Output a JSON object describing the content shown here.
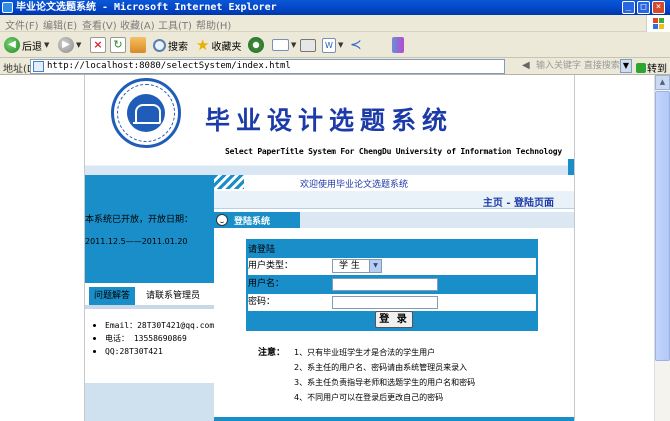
{
  "window": {
    "title": "毕业论文选题系统 - Microsoft Internet Explorer",
    "minimize": "_",
    "maximize": "□",
    "close": "×"
  },
  "menu": [
    "文件(F)",
    "编辑(E)",
    "查看(V)",
    "收藏(A)",
    "工具(T)",
    "帮助(H)"
  ],
  "toolbar": {
    "back": "后退",
    "search": "搜索",
    "favorites": "收藏夹"
  },
  "address": {
    "label": "地址(D)",
    "url": "http://localhost:8080/selectSystem/index.html",
    "search_placeholder": "输入关键字 直接搜索",
    "go": "转到"
  },
  "banner": {
    "title": "毕业设计选题系统",
    "subtitle": "Select PaperTitle System For ChengDu University of Information Technology"
  },
  "left": {
    "notice_line1": "本系统已开放，开放日期：",
    "notice_line2": "2011.12.5——2011.01.20",
    "tabs": [
      "问题解答",
      "请联系管理员"
    ],
    "contacts": [
      "Email：28T30T421@qq.com",
      "电话： 13558690869",
      "QQ:28T30T421"
    ]
  },
  "right": {
    "welcome": "欢迎使用毕业论文选题系统",
    "breadcrumb": "主页 - 登陆页面",
    "section_title": "登陆系统",
    "login": {
      "caption": "请登陆",
      "user_type_label": "用户类型：",
      "user_type_value": "学 生",
      "username_label": "用户名：",
      "password_label": "密码：",
      "submit": "登 录"
    },
    "notes_head": "注意：",
    "notes": [
      "1、只有毕业班学生才是合法的学生用户",
      "2、系主任的用户名、密码请由系统管理员来录入",
      "3、系主任负责指导老师和选题学生的用户名和密码",
      "4、不同用户可以在登录后更改自己的密码"
    ]
  },
  "colors": {
    "accent": "#1a8ec8",
    "title_blue": "#1c3aa8",
    "titlebar": "#0a58d6"
  }
}
